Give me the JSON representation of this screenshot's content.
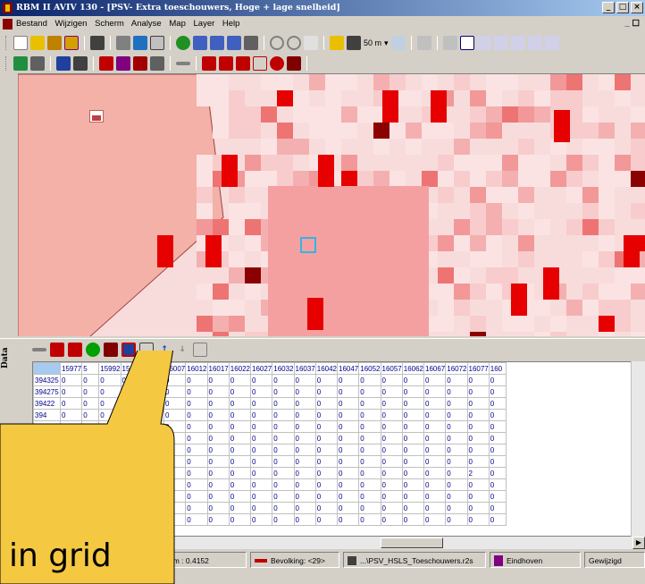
{
  "window": {
    "title": "RBM II AVIV 130 - [PSV- Extra toeschouwers, Hoge + lage snelheid]",
    "controls": [
      "_",
      "□",
      "×"
    ]
  },
  "menubar": {
    "items": [
      "Bestand",
      "Wijzigen",
      "Scherm",
      "Analyse",
      "Map",
      "Layer",
      "Help"
    ],
    "mdi_controls": "_ ☐"
  },
  "toolbar1": {
    "scale_label": "50 m"
  },
  "data_panel": {
    "label": "Data",
    "column_headers": [
      "15977",
      "5",
      "15992",
      "15997",
      "16002",
      "16007",
      "16012",
      "16017",
      "16022",
      "16027",
      "16032",
      "16037",
      "16042",
      "16047",
      "16052",
      "16057",
      "16062",
      "16067",
      "16072",
      "16077",
      "160"
    ],
    "row_headers": [
      "394325",
      "394275",
      "39422",
      "394",
      "",
      "",
      "",
      "",
      "",
      "",
      "",
      "",
      ""
    ],
    "cell_value": "0",
    "special_cell": {
      "row": 8,
      "col": 19,
      "value": "2"
    }
  },
  "statusbar": {
    "zoom": "om : 0.4152",
    "layer": "Bevolking: <29>",
    "file": "...\\PSV_HSLS_Toeschouwers.r2s",
    "location": "Eindhoven",
    "state": "Gewijzigd"
  },
  "callout": {
    "text": "in grid"
  },
  "colors": {
    "title_start": "#0a246a",
    "title_end": "#a6caf0",
    "map_light": "#f8dcdc",
    "map_mid": "#f5a0a0",
    "map_dark": "#8b0000",
    "map_red": "#e60000",
    "callout_fill": "#f5c842",
    "highlight_cell": "#33b5e5"
  }
}
